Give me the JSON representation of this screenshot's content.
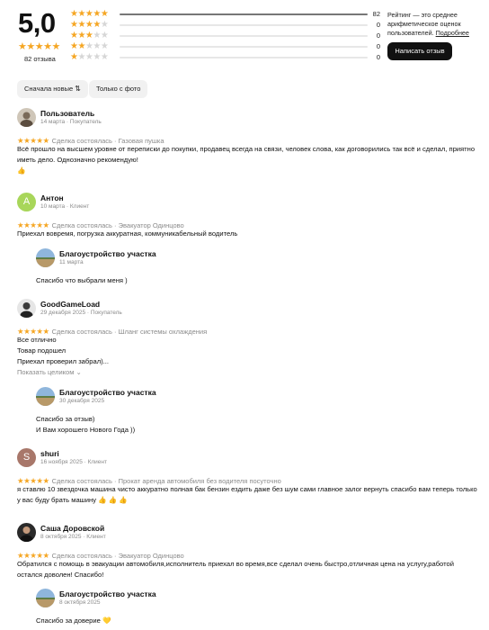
{
  "summary": {
    "score": "5,0",
    "stars": "★★★★★",
    "count_label": "82 отзыва",
    "breakdown": [
      {
        "stars": 5,
        "count": "82",
        "fraction": 1.0
      },
      {
        "stars": 4,
        "count": "0",
        "fraction": 0
      },
      {
        "stars": 3,
        "count": "0",
        "fraction": 0
      },
      {
        "stars": 2,
        "count": "0",
        "fraction": 0
      },
      {
        "stars": 1,
        "count": "0",
        "fraction": 0
      }
    ],
    "note_text": "Рейтинг — это среднее арифметическое оценок пользователей.",
    "note_link": "Подробнее",
    "write_button": "Написать отзыв",
    "star_color": "#f5a623"
  },
  "filters": {
    "sort_label": "Сначала новые",
    "sort_icon": "⇅",
    "photo_label": "Только с фото"
  },
  "reviews": [
    {
      "author": "Пользователь",
      "meta": "14 марта · Покупатель",
      "stars": "★★★★★",
      "deal": "Сделка состоялась · Газовая пушка",
      "text": "Всё прошло на высшем уровне от переписки до покупки, продавец всегда на связи, человек слова, как договорились так всё и сделал, приятно иметь дело. Однозначно рекомендую!",
      "emoji": "👍"
    },
    {
      "author": "Антон",
      "avatar_letter": "А",
      "avatar_color": "#a8d65a",
      "meta": "10 марта · Клиент",
      "stars": "★★★★★",
      "deal": "Сделка состоялась · Эвакуатор Одинцово",
      "text": "Приехал вовремя, погрузка аккуратная, коммуникабельный водитель",
      "reply": {
        "author": "Благоустройство участка",
        "date": "11 марта",
        "text": "Спасибо что выбрали меня )"
      }
    },
    {
      "author": "GoodGameLoad",
      "meta": "29 декабря 2025 · Покупатель",
      "stars": "★★★★★",
      "deal": "Сделка состоялась · Шланг системы охлаждения",
      "lines": [
        "Все отлично",
        "Товар подошел",
        "Приехал проверил забрал)..."
      ],
      "show_more": "Показать целиком ⌄",
      "reply": {
        "author": "Благоустройство участка",
        "date": "30 декабря 2025",
        "lines": [
          "Спасибо за отзыв)",
          "И Вам хорошего Нового Года ))"
        ]
      }
    },
    {
      "author": "shuri",
      "avatar_letter": "S",
      "avatar_color": "#a8776a",
      "meta": "16 ноября 2025 · Клиент",
      "stars": "★★★★★",
      "deal": "Сделка состоялась · Прокат аренда автомобиля без водителя посуточно",
      "text": "я ставлю 10 звездочка машина чисто аккуратно полная бак бензин ездить даже без шум сами главное залог вернуть спасибо вам теперь только у вас буду брать машину 👍 👍 👍"
    },
    {
      "author": "Саша Доровской",
      "meta": "8 октября 2025 · Клиент",
      "stars": "★★★★★",
      "deal": "Сделка состоялась · Эвакуатор Одинцово",
      "text": "Обратился с помощь в эвакуации автомобиля,исполнитель приехал во время,все сделал очень быстро,отличная цена на услугу,работой остался доволен! Спасибо!",
      "reply": {
        "author": "Благоустройство участка",
        "date": "8 октября 2025",
        "text": "Спасибо за доверие 💛"
      }
    }
  ]
}
